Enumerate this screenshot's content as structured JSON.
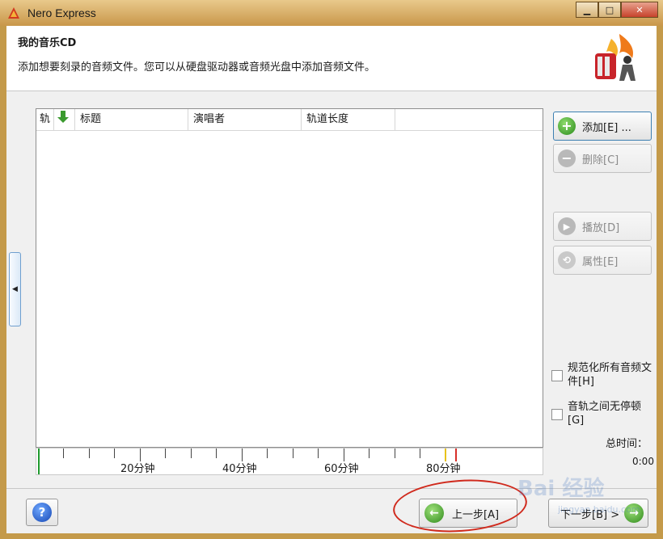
{
  "window": {
    "title": "Nero Express"
  },
  "header": {
    "title": "我的音乐CD",
    "description": "添加想要刻录的音频文件。您可以从硬盘驱动器或音频光盘中添加音频文件。"
  },
  "list": {
    "columns": [
      "轨",
      "",
      "标题",
      "演唱者",
      "轨道长度"
    ]
  },
  "timeline": {
    "labels": [
      "20分钟",
      "40分钟",
      "60分钟",
      "80分钟"
    ]
  },
  "buttons": {
    "add": "添加[E] ...",
    "delete": "删除[C]",
    "play": "播放[D]",
    "properties": "属性[E]"
  },
  "options": {
    "normalize": "规范化所有音频文件[H]",
    "no_pause": "音轨之间无停顿[G]"
  },
  "total": {
    "label": "总时间：",
    "value": "0:00"
  },
  "footer": {
    "back": "上一步[A]",
    "next": "下一步[B] >"
  },
  "icons": [
    "nero-app-icon",
    "minimize-icon",
    "maximize-icon",
    "close-icon",
    "add-icon",
    "remove-icon",
    "play-icon",
    "properties-icon",
    "help-icon",
    "back-arrow-icon",
    "next-arrow-icon"
  ],
  "colors": {
    "titlebar": "#c9974a",
    "accent_green": "#2f8a1c",
    "annotation": "#d02a1d"
  },
  "watermark": {
    "text": "Bai 经验",
    "url": "jingyan.baidu.com"
  }
}
